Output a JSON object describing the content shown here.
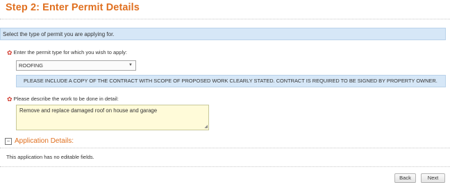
{
  "step": {
    "title": "Step 2: Enter Permit Details"
  },
  "section": {
    "header": "Select the type of permit you are applying for."
  },
  "permit_type": {
    "label": "Enter the permit type for which you wish to apply:",
    "selected_value": "ROOFING",
    "notice": "PLEASE INCLUDE A COPY OF THE CONTRACT WITH SCOPE OF PROPOSED WORK CLEARLY STATED. CONTRACT IS REQUIRED TO BE SIGNED BY PROPERTY OWNER."
  },
  "work_description": {
    "label": "Please describe the work to be done in detail:",
    "value": "Remove and replace damaged roof on house and garage"
  },
  "application_details": {
    "title": "Application Details:",
    "toggle_symbol": "−",
    "message": "This application has no editable fields."
  },
  "buttons": {
    "back": "Back",
    "next": "Next"
  },
  "icons": {
    "required": "required-star-icon",
    "dropdown": "chevron-down-icon",
    "collapse": "collapse-icon"
  },
  "colors": {
    "accent": "#e07020",
    "section_bg": "#d6e7f7",
    "textarea_bg": "#fffbd9",
    "required": "#d23a2e"
  }
}
